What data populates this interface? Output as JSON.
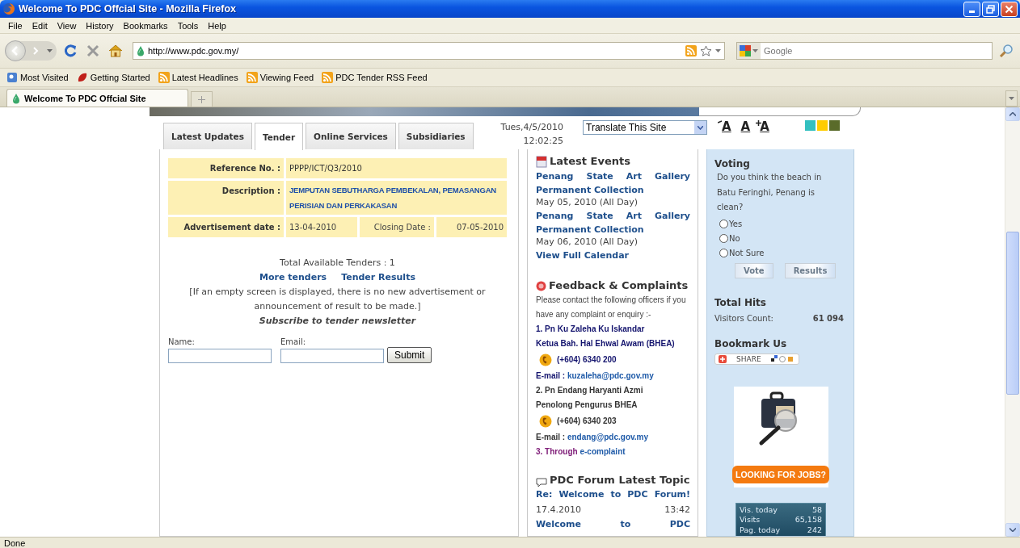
{
  "window": {
    "title": "Welcome To PDC Offcial Site - Mozilla Firefox"
  },
  "menu": [
    "File",
    "Edit",
    "View",
    "History",
    "Bookmarks",
    "Tools",
    "Help"
  ],
  "address_bar": {
    "value": "http://www.pdc.gov.my/"
  },
  "search_box": {
    "placeholder": "Google"
  },
  "bookmarks": [
    {
      "label": "Most Visited",
      "kind": "folder"
    },
    {
      "label": "Getting Started",
      "kind": "page"
    },
    {
      "label": "Latest Headlines",
      "kind": "feed"
    },
    {
      "label": "Viewing Feed",
      "kind": "feed"
    },
    {
      "label": "PDC Tender RSS Feed",
      "kind": "feed"
    }
  ],
  "browser_tabs": [
    {
      "label": "Welcome To PDC Offcial Site",
      "selected": true
    }
  ],
  "page": {
    "site_tabs": [
      {
        "label": "Latest Updates",
        "selected": false
      },
      {
        "label": "Tender",
        "selected": true
      },
      {
        "label": "Online Services",
        "selected": false
      },
      {
        "label": "Subsidiaries",
        "selected": false
      }
    ],
    "date": "Tues,4/5/2010",
    "time": "12:02:25",
    "translate": {
      "value": "Translate This Site"
    },
    "font_sizes": [
      {
        "kind": "decrease",
        "label": "A"
      },
      {
        "kind": "normal",
        "label": "A"
      },
      {
        "kind": "increase",
        "label": "A"
      }
    ],
    "color_themes": [
      {
        "color": "#33c0c0"
      },
      {
        "color": "#ffcc00"
      },
      {
        "color": "#5a6b2a"
      }
    ],
    "tender": {
      "reference_label": "Reference No. :",
      "reference": "PPPP/ICT/Q3/2010",
      "description_label": "Description :",
      "description": "JEMPUTAN SEBUTHARGA PEMBEKALAN, PEMASANGAN PERISIAN DAN PERKAKASAN",
      "ad_date_label": "Advertisement date :",
      "ad_date": "13-04-2010",
      "closing_label": "Closing Date :",
      "closing_date": "07-05-2010",
      "total": "Total Available Tenders : 1",
      "links": [
        "More tenders",
        "Tender Results"
      ],
      "note": "[If an empty screen is displayed, there is no new advertisement or announcement of result to be made.]",
      "subscribe": "Subscribe to tender newsletter",
      "name_label": "Name:",
      "email_label": "Email:",
      "submit": "Submit"
    },
    "events": {
      "title": "Latest Events",
      "items": [
        {
          "title": "Penang State Art Gallery Permanent Collection",
          "date": "May 05, 2010 (All Day)"
        },
        {
          "title": "Penang State Art Gallery Permanent Collection",
          "date": "May 06, 2010 (All Day)"
        }
      ],
      "calendar_link": "View Full Calendar"
    },
    "feedback": {
      "title": "Feedback & Complaints",
      "intro": "Please contact the following officers if you have any complaint or enquiry :-",
      "officers": [
        {
          "name": "1. Pn Ku Zaleha Ku Iskandar",
          "position": "Ketua Bah. Hal Ehwal Awam (BHEA)",
          "phone": "(+604) 6340 200",
          "email_label": "E-mail :",
          "email": "kuzaleha@pdc.gov.my",
          "color": "#14146e"
        },
        {
          "name": "2. Pn Endang Haryanti Azmi",
          "position": "Penolong Pengurus BHEA",
          "phone": "(+604) 6340 203",
          "email_label": "E-mail :",
          "email": "endang@pdc.gov.my",
          "color": "#333333"
        }
      ],
      "through": "3. Through",
      "through_link": "e-complaint"
    },
    "forum": {
      "title": "PDC Forum Latest Topic",
      "topics": [
        {
          "title": "Re: Welcome to PDC Forum!",
          "date": "17.4.2010",
          "time": "13:42"
        },
        {
          "title": "Welcome to PDC"
        }
      ]
    },
    "voting": {
      "title": "Voting",
      "question": "Do you think the beach in Batu Feringhi, Penang is clean?",
      "options": [
        {
          "label": "Yes",
          "selected": false
        },
        {
          "label": "No",
          "selected": false
        },
        {
          "label": "Not Sure",
          "selected": false
        }
      ],
      "buttons": [
        "Vote",
        "Results"
      ]
    },
    "hits": {
      "title": "Total Hits",
      "label": "Visitors Count:",
      "value": "61 094"
    },
    "bookmark": {
      "title": "Bookmark Us",
      "share": "SHARE"
    },
    "jobs_banner": {
      "text": "LOOKING FOR JOBS?"
    },
    "counter": [
      {
        "label": "Vis. today",
        "value": "58"
      },
      {
        "label": "Visits",
        "value": "65,158"
      },
      {
        "label": "Pag. today",
        "value": "242"
      }
    ]
  },
  "status_bar": {
    "text": "Done"
  }
}
